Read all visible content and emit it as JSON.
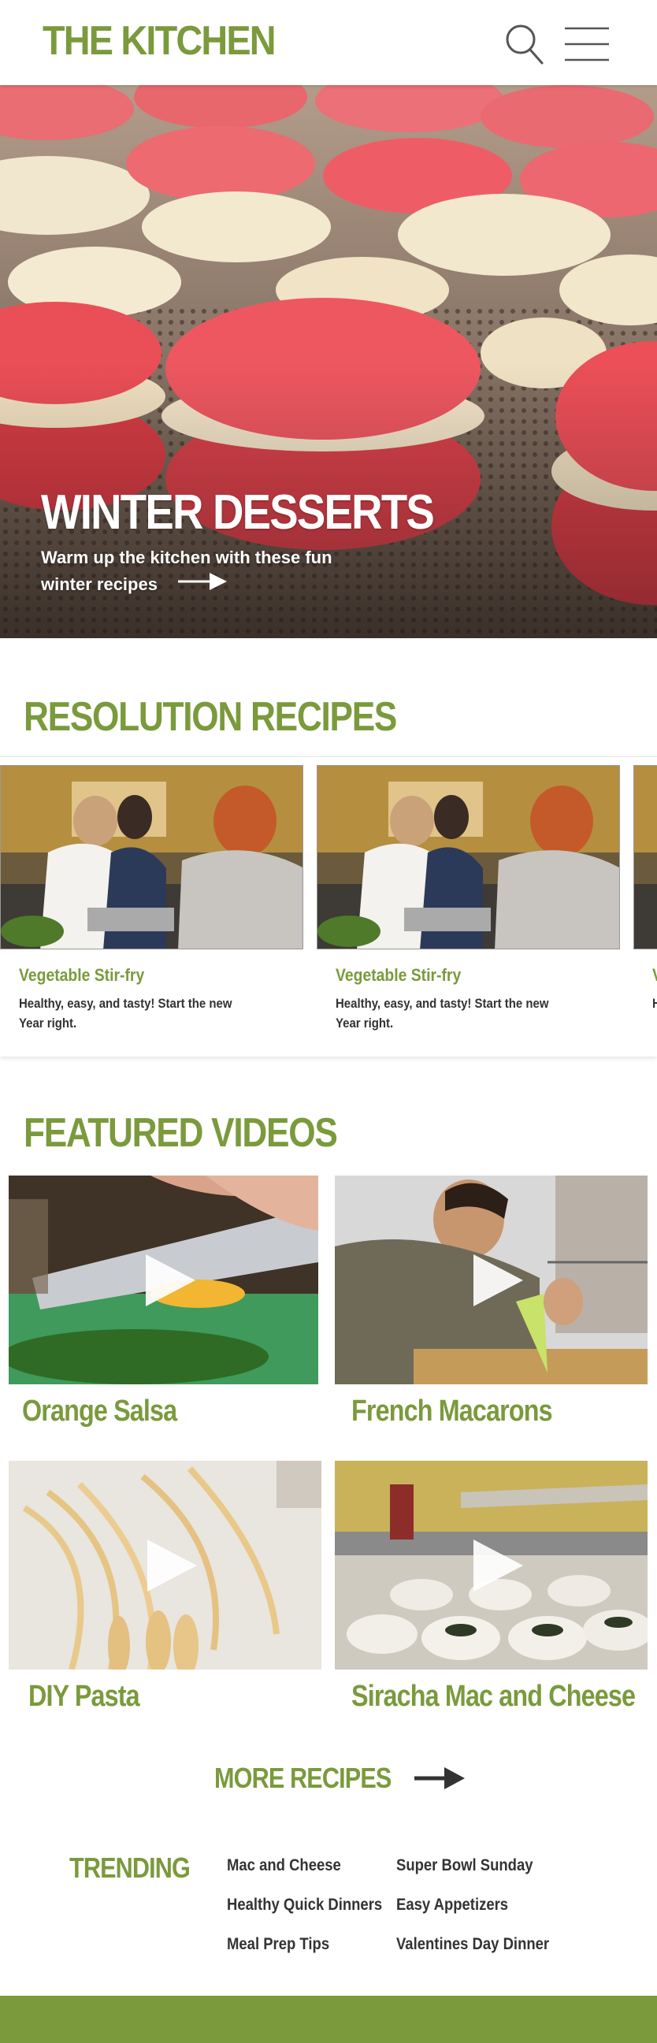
{
  "header": {
    "logo": "THE KITCHEN",
    "search_icon": "search-icon",
    "menu_icon": "hamburger-menu-icon"
  },
  "hero": {
    "title": "WINTER DESSERTS",
    "subtitle": "Warm up the kitchen with these fun winter recipes",
    "arrow_icon": "arrow-right-icon"
  },
  "resolution": {
    "title": "RESOLUTION RECIPES",
    "cards": [
      {
        "title": "Vegetable Stir-fry",
        "desc": "Healthy, easy, and tasty! Start the new Year right."
      },
      {
        "title": "Vegetable Stir-fry",
        "desc": "Healthy, easy, and tasty! Start the new Year right."
      },
      {
        "title": "V",
        "desc": "H Y"
      }
    ]
  },
  "videos": {
    "title": "FEATURED VIDEOS",
    "items": [
      {
        "title": "Orange Salsa"
      },
      {
        "title": "French Macarons"
      },
      {
        "title": "DIY Pasta"
      },
      {
        "title": "Siracha Mac and Cheese"
      }
    ],
    "play_icon": "play-icon"
  },
  "more_recipes": {
    "label": "MORE RECIPES",
    "arrow_icon": "arrow-right-icon"
  },
  "trending": {
    "label": "TRENDING",
    "links": [
      "Mac and Cheese",
      "Super Bowl Sunday",
      "Healthy Quick Dinners",
      "Easy Appetizers",
      "Meal Prep Tips",
      "Valentines Day Dinner"
    ]
  },
  "colors": {
    "brand_green": "#7a9a3c",
    "white": "#ffffff",
    "text_dark": "#333333"
  }
}
